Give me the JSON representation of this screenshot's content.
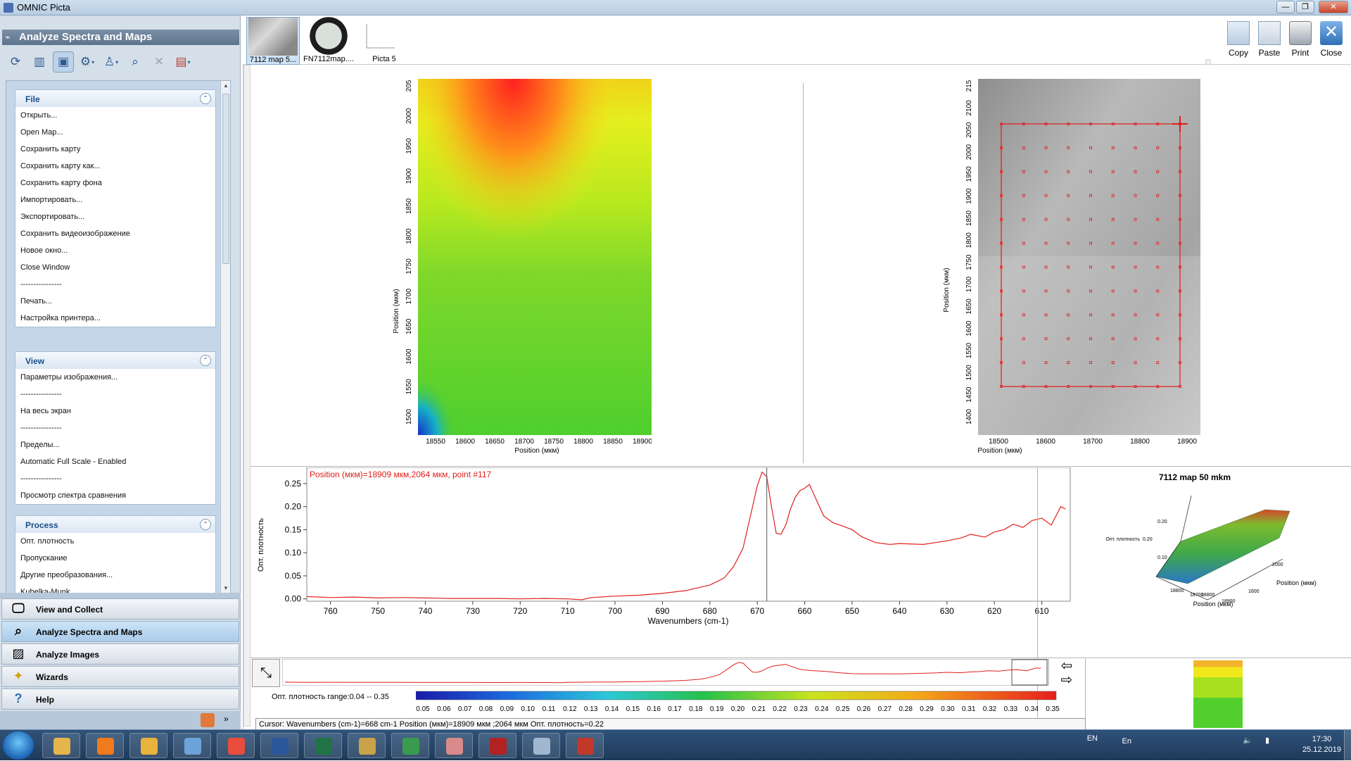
{
  "window": {
    "title": "OMNIC Picta",
    "controls": {
      "minimize": "—",
      "maximize": "❐",
      "close": "✕"
    }
  },
  "left_panel": {
    "header": "Analyze Spectra and Maps",
    "groups": [
      {
        "title": "File",
        "items": [
          "Открыть...",
          "Open Map...",
          "Сохранить карту",
          "Сохранить карту как...",
          "Сохранить карту фона",
          "Импортировать...",
          "Экспортировать...",
          "Сохранить видеоизображение",
          "Новое окно...",
          "Close Window",
          "----------------",
          "Печать...",
          "Настройка принтера..."
        ]
      },
      {
        "title": "View",
        "items": [
          "Параметры изображения...",
          "----------------",
          "На весь экран",
          "----------------",
          "Пределы...",
          "Automatic Full Scale - Enabled",
          "----------------",
          "Просмотр спектра сравнения"
        ]
      },
      {
        "title": "Process",
        "items": [
          "Опт. плотность",
          "Пропускание",
          "Другие преобразования...",
          "Kubelka-Munk"
        ]
      }
    ],
    "nav": [
      "View and Collect",
      "Analyze Spectra and Maps",
      "Analyze Images",
      "Wizards",
      "Help"
    ],
    "collapse_glyph": "⌃"
  },
  "thumbnails": [
    {
      "label": "7112 map 5..."
    },
    {
      "label": "FN7112map...."
    },
    {
      "label": "Picta 5"
    }
  ],
  "toolbar_right": [
    "Copy",
    "Paste",
    "Print",
    "Close"
  ],
  "map_left": {
    "ylabel": "Position (мкм)",
    "xlabel": "Position (мкм)",
    "yticks": [
      "205",
      "2000",
      "1950",
      "1900",
      "1850",
      "1800",
      "1750",
      "1700",
      "1650",
      "1600",
      "1550",
      "1500"
    ],
    "xticks": [
      "18550",
      "18600",
      "18650",
      "18700",
      "18750",
      "18800",
      "18850",
      "18900"
    ]
  },
  "map_right": {
    "ylabel": "Position (мкм)",
    "xlabel": "Position (мкм)",
    "yticks": [
      "215",
      "2100",
      "2050",
      "2000",
      "1950",
      "1900",
      "1850",
      "1800",
      "1750",
      "1700",
      "1650",
      "1600",
      "1550",
      "1500",
      "1450",
      "1400"
    ],
    "xticks": [
      "18500",
      "18600",
      "18700",
      "18800",
      "18900"
    ],
    "grid": {
      "columns": 9,
      "rows": 12
    }
  },
  "spectrum": {
    "header": "Position (мкм)=18909 мкм,2064 мкм, point #117",
    "ylabel": "Опт. плотность",
    "xlabel": "Wavenumbers (cm-1)",
    "cursor_x": 668
  },
  "chart_data": {
    "type": "line",
    "title": "",
    "xlabel": "Wavenumbers (cm-1)",
    "ylabel": "Опт. плотность",
    "xlim": [
      765,
      604
    ],
    "ylim": [
      -0.005,
      0.285
    ],
    "xticks": [
      760,
      750,
      740,
      730,
      720,
      710,
      700,
      690,
      680,
      670,
      660,
      650,
      640,
      630,
      620,
      610
    ],
    "yticks": [
      0.0,
      0.05,
      0.1,
      0.15,
      0.2,
      0.25
    ],
    "ytick_labels": [
      "0.00",
      "0.05",
      "0.10",
      "0.15",
      "0.20",
      "0.25"
    ],
    "series": [
      {
        "color": "#e0201b",
        "x": [
          765,
          760,
          755,
          750,
          745,
          740,
          735,
          730,
          725,
          720,
          715,
          710,
          707,
          705,
          700,
          695,
          690,
          685,
          680,
          677,
          675,
          673,
          671,
          670,
          669,
          668,
          667,
          666,
          665,
          664,
          663,
          662,
          661,
          660,
          659,
          658,
          656,
          654,
          652,
          650,
          648,
          645,
          642,
          640,
          635,
          630,
          627,
          625,
          622,
          620,
          618,
          616,
          614,
          612,
          610,
          608,
          606,
          605
        ],
        "y": [
          0.005,
          0.003,
          0.004,
          0.002,
          0.003,
          0.002,
          0.001,
          0.001,
          0.001,
          0.0,
          0.001,
          0.0,
          -0.002,
          0.003,
          0.006,
          0.008,
          0.012,
          0.018,
          0.03,
          0.045,
          0.07,
          0.11,
          0.2,
          0.245,
          0.275,
          0.265,
          0.2,
          0.142,
          0.14,
          0.16,
          0.195,
          0.22,
          0.235,
          0.24,
          0.248,
          0.225,
          0.18,
          0.165,
          0.158,
          0.15,
          0.135,
          0.122,
          0.118,
          0.12,
          0.118,
          0.126,
          0.132,
          0.14,
          0.134,
          0.145,
          0.15,
          0.162,
          0.155,
          0.17,
          0.175,
          0.16,
          0.2,
          0.195
        ]
      }
    ]
  },
  "surface": {
    "title": "7112 map 50 mkm",
    "zlabel": "Опт. плотность",
    "z_ticks": [
      "0.20",
      "0.20",
      "0.10"
    ],
    "x_ticks": [
      "18800",
      "18700",
      "18900"
    ],
    "x_tick_extra": "18800",
    "y_ticks": [
      "2000",
      "1600"
    ],
    "axis_label_x": "Position (мкм)",
    "axis_label_y": "Position (мкм)"
  },
  "colorscale": {
    "range_label": "Опт. плотность range:0.04 -- 0.35",
    "ticks": [
      "0.05",
      "0.06",
      "0.07",
      "0.08",
      "0.09",
      "0.10",
      "0.11",
      "0.12",
      "0.13",
      "0.14",
      "0.15",
      "0.16",
      "0.17",
      "0.18",
      "0.19",
      "0.20",
      "0.21",
      "0.22",
      "0.23",
      "0.24",
      "0.25",
      "0.26",
      "0.27",
      "0.28",
      "0.29",
      "0.30",
      "0.31",
      "0.32",
      "0.33",
      "0.34",
      "0.35"
    ]
  },
  "status": {
    "cursor": "Cursor: Wavenumbers (cm-1)=668 cm-1  Position (мкм)=18909 мкм ;2064 мкм  Опт. плотность=0.22"
  },
  "taskbar": {
    "apps": [
      "explorer",
      "firefox",
      "app-3",
      "app-4",
      "chrome",
      "word",
      "excel",
      "paint",
      "icd",
      "app-10",
      "omnic",
      "app-12",
      "pdf"
    ],
    "lang": "EN",
    "tray_lang": "En",
    "time": "17:30",
    "date": "25.12.2019"
  },
  "colors": {
    "spectrum_line": "#e0201b",
    "panel_header": "#5e738d",
    "group_title": "#1a4e8a"
  }
}
